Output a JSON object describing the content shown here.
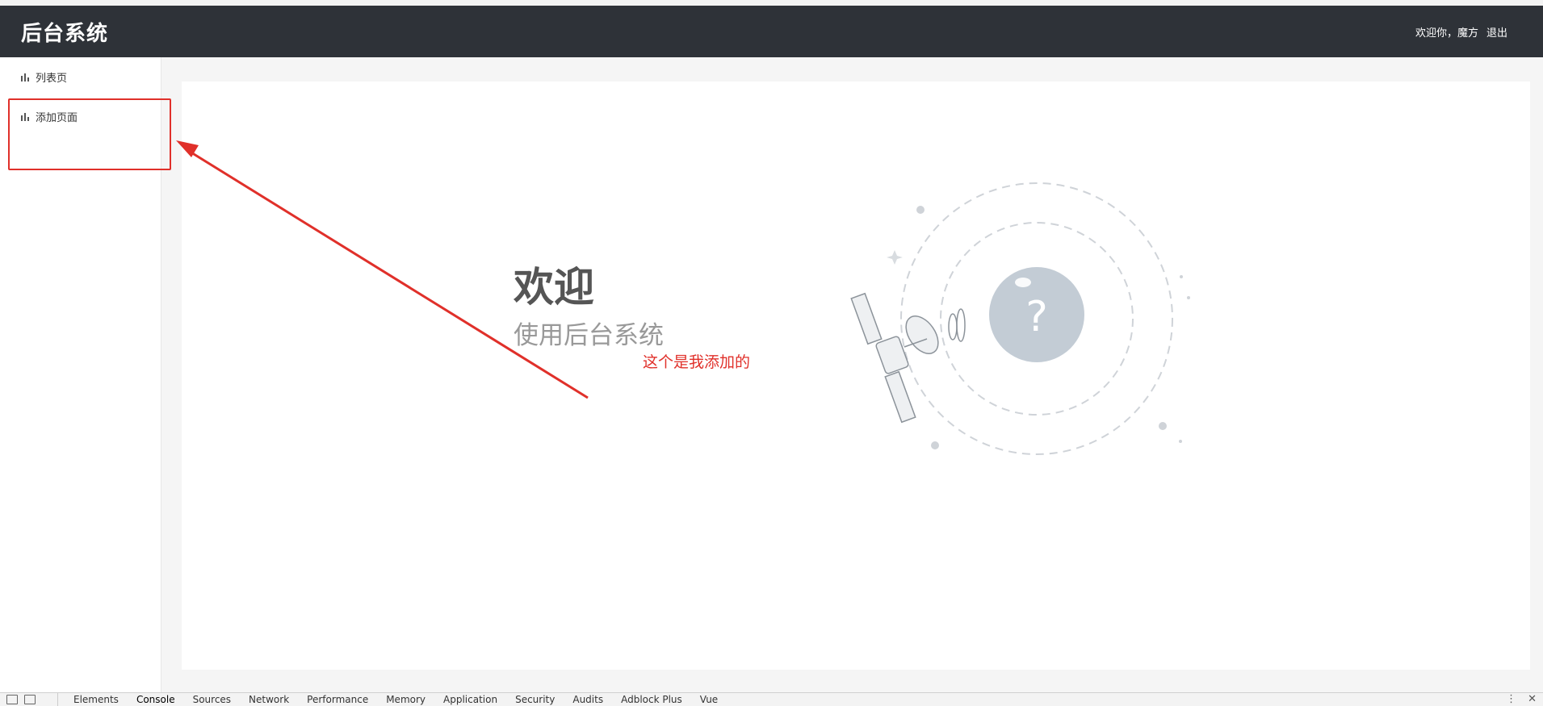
{
  "header": {
    "brand": "后台系统",
    "welcome_user": "欢迎你，魔方",
    "logout": "退出"
  },
  "sidebar": {
    "items": [
      {
        "label": "列表页",
        "icon": "bar-chart-icon"
      },
      {
        "label": "添加页面",
        "icon": "bar-chart-icon"
      }
    ]
  },
  "main": {
    "title": "欢迎",
    "subtitle": "使用后台系统"
  },
  "annotation": {
    "text": "这个是我添加的",
    "color": "#e0302a"
  },
  "devtools": {
    "tabs": [
      "Elements",
      "Console",
      "Sources",
      "Network",
      "Performance",
      "Memory",
      "Application",
      "Security",
      "Audits",
      "Adblock Plus",
      "Vue"
    ],
    "active_tab": "Console",
    "menu_glyph": "⋮",
    "close_glyph": "✕"
  },
  "colors": {
    "header_bg": "#2e3238",
    "annotation_red": "#e0302a"
  }
}
